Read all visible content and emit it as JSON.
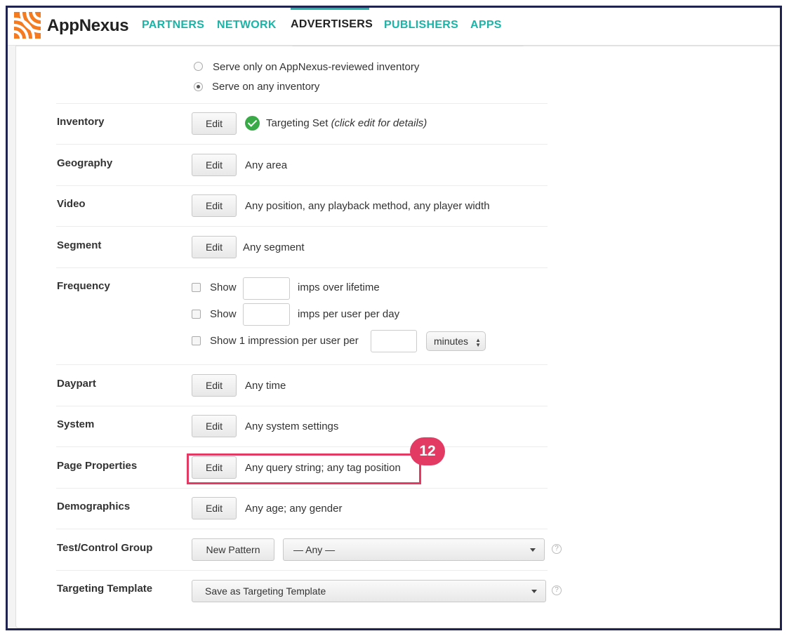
{
  "header": {
    "brand": "AppNexus",
    "nav": [
      {
        "label": "PARTNERS"
      },
      {
        "label": "NETWORK"
      },
      {
        "label": "ADVERTISERS"
      },
      {
        "label": "PUBLISHERS"
      },
      {
        "label": "APPS"
      }
    ],
    "active_nav": "ADVERTISERS",
    "accent_color": "#1db3a6",
    "logo_color": "#f47b20"
  },
  "inventory_radios": [
    {
      "label": "Serve only on AppNexus-reviewed inventory",
      "selected": false
    },
    {
      "label": "Serve on any inventory",
      "selected": true
    }
  ],
  "rows": {
    "inventory": {
      "label": "Inventory",
      "button": "Edit",
      "status_text": "Targeting Set",
      "status_hint": "(click edit for details)",
      "status_icon": "check-circle-icon"
    },
    "geography": {
      "label": "Geography",
      "button": "Edit",
      "value": "Any area"
    },
    "video": {
      "label": "Video",
      "button": "Edit",
      "value": "Any position, any playback method, any player width"
    },
    "segment": {
      "label": "Segment",
      "button": "Edit",
      "value": "Any segment"
    },
    "frequency": {
      "label": "Frequency",
      "line1": {
        "prefix": "Show",
        "suffix": "imps over lifetime",
        "value": ""
      },
      "line2": {
        "prefix": "Show",
        "suffix": "imps per user per day",
        "value": ""
      },
      "line3": {
        "prefix": "Show 1 impression per user per",
        "value": "",
        "unit": "minutes"
      }
    },
    "daypart": {
      "label": "Daypart",
      "button": "Edit",
      "value": "Any time"
    },
    "system": {
      "label": "System",
      "button": "Edit",
      "value": "Any system settings"
    },
    "page_properties": {
      "label": "Page Properties",
      "button": "Edit",
      "value": "Any query string; any tag position"
    },
    "demographics": {
      "label": "Demographics",
      "button": "Edit",
      "value": "Any age; any gender"
    },
    "test_control": {
      "label": "Test/Control Group",
      "button": "New Pattern",
      "select": "— Any —"
    },
    "targeting_template": {
      "label": "Targeting Template",
      "select": "Save as Targeting Template"
    }
  },
  "callout": {
    "number": "12",
    "color": "#e23a62"
  },
  "help_glyph": "?"
}
